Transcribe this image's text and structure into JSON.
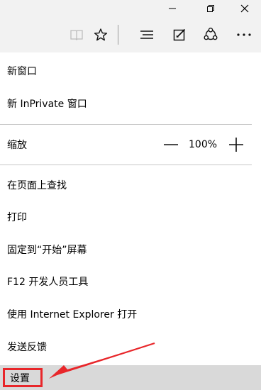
{
  "window": {
    "controls": [
      {
        "id": "minimize",
        "icon": "minimize-icon"
      },
      {
        "id": "maximize",
        "icon": "restore-icon"
      },
      {
        "id": "close",
        "icon": "close-icon"
      }
    ]
  },
  "toolbar": {
    "icons": [
      "reading-view-icon",
      "favorite-star-icon",
      "hub-icon",
      "web-note-icon",
      "share-icon",
      "more-icon"
    ]
  },
  "menu": {
    "new_window": "新窗口",
    "new_inprivate": "新 InPrivate 窗口",
    "zoom_label": "缩放",
    "zoom_value": "100%",
    "find_on_page": "在页面上查找",
    "print": "打印",
    "pin_to_start": "固定到“开始”屏幕",
    "dev_tools": "F12 开发人员工具",
    "open_with_ie": "使用 Internet Explorer 打开",
    "feedback": "发送反馈",
    "settings": "设置"
  },
  "annotation": {
    "highlight_color": "#e8262a",
    "arrow_color": "#e8262a",
    "selected_row_color": "#d9d9d9"
  }
}
